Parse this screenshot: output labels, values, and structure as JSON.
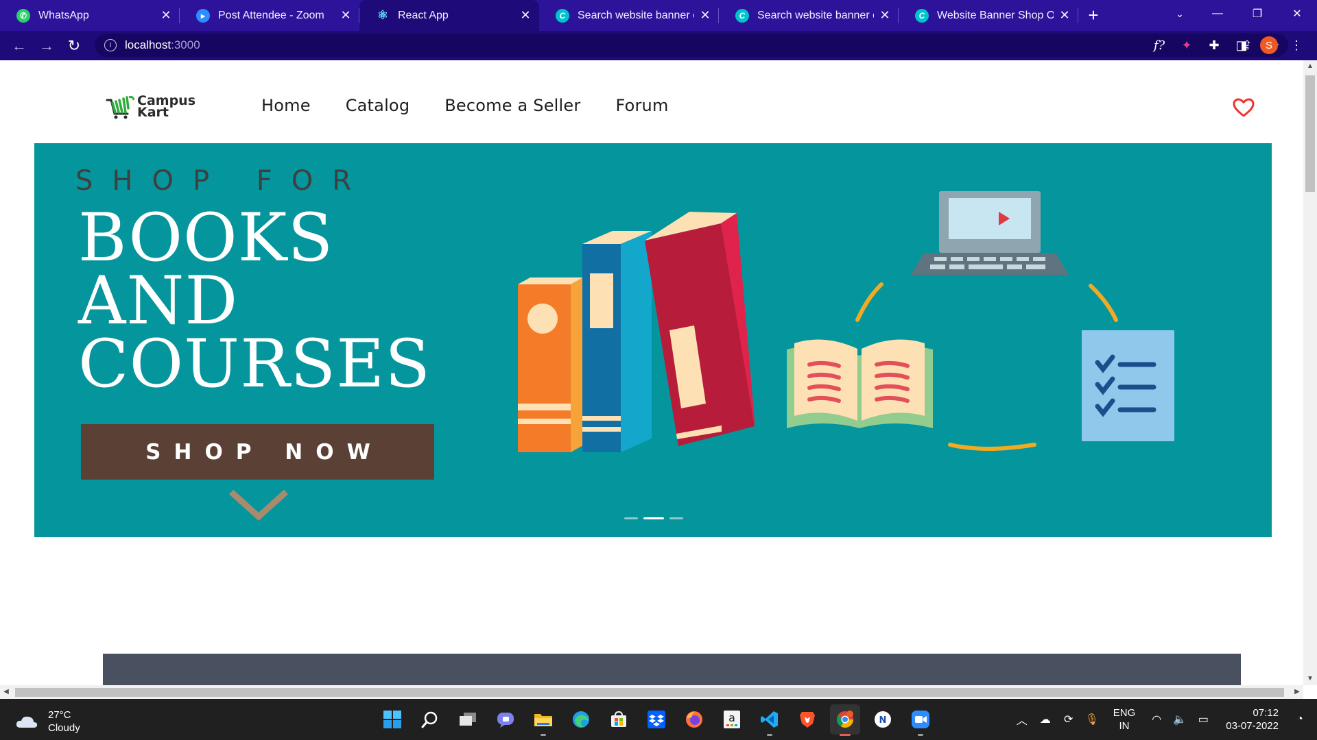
{
  "browser": {
    "tabs": [
      {
        "title": "WhatsApp",
        "icon": "whatsapp-icon",
        "color": "#25d366",
        "active": false
      },
      {
        "title": "Post Attendee - Zoom",
        "icon": "zoom-icon",
        "color": "#2d8cff",
        "active": false
      },
      {
        "title": "React App",
        "icon": "react-icon",
        "color": "#61dafb",
        "active": true
      },
      {
        "title": "Search website banner ecor",
        "icon": "canva-icon",
        "color": "#00c4cc",
        "active": false
      },
      {
        "title": "Search website banner ecor",
        "icon": "canva-icon",
        "color": "#00c4cc",
        "active": false
      },
      {
        "title": "Website Banner Shop Our N",
        "icon": "canva-icon",
        "color": "#00c4cc",
        "active": false
      }
    ],
    "address": {
      "host": "localhost",
      "port": ":3000"
    },
    "theme_color": "#2d139a",
    "profile_initial": "S"
  },
  "site": {
    "brand_line1": "Campus",
    "brand_line2": "Kart",
    "nav": [
      "Home",
      "Catalog",
      "Become a Seller",
      "Forum"
    ],
    "hero": {
      "kicker": "SHOP FOR",
      "headline_line1": "BOOKS",
      "headline_line2": "AND",
      "headline_line3": "COURSES",
      "cta": "SHOP NOW",
      "background": "#05959d",
      "carousel_slides": 3,
      "carousel_active": 2
    }
  },
  "taskbar": {
    "weather_temp": "27°C",
    "weather_desc": "Cloudy",
    "lang_line1": "ENG",
    "lang_line2": "IN",
    "time": "07:12",
    "date": "03-07-2022",
    "apps": [
      "start-icon",
      "search-icon",
      "task-view-icon",
      "teams-chat-icon",
      "file-explorer-icon",
      "edge-icon",
      "store-icon",
      "dropbox-icon",
      "firefox-icon",
      "amazon-icon",
      "vscode-icon",
      "brave-icon",
      "chrome-icon",
      "notion-icon",
      "zoom-icon"
    ]
  }
}
